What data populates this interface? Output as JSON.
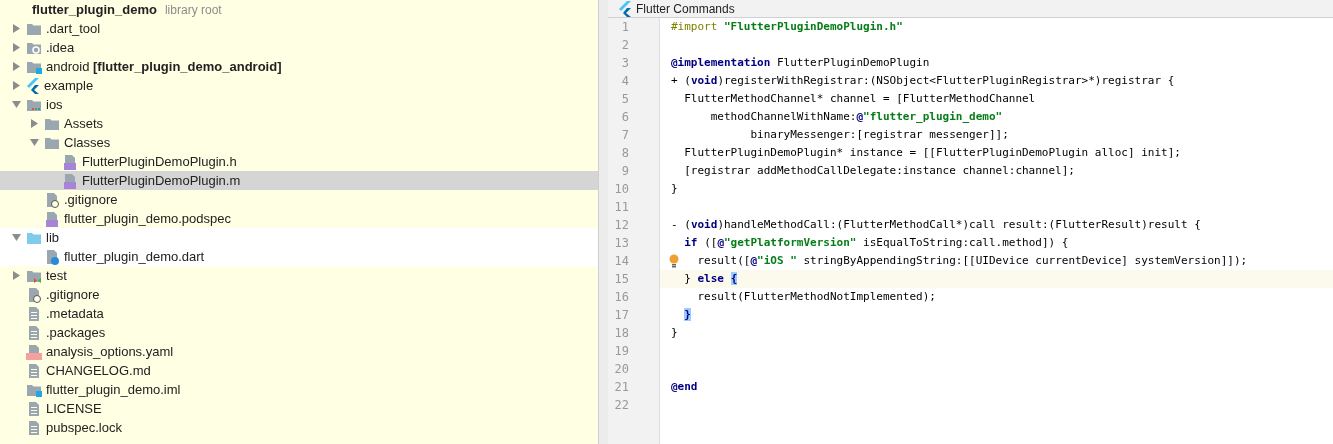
{
  "project_tree": {
    "root": {
      "label": "flutter_plugin_demo",
      "note": "library root"
    },
    "items": [
      {
        "label": ".dart_tool",
        "kind": "folder",
        "expanded": false,
        "selected": false,
        "color": "#ffffe4"
      },
      {
        "label": ".idea",
        "kind": "folder-idea",
        "expanded": false,
        "selected": false,
        "color": "#ffffe4"
      },
      {
        "label": "android **[flutter_plugin_demo_android]**",
        "kind": "folder-module",
        "expanded": false,
        "selected": false,
        "color": "#ffffe4"
      },
      {
        "label": "example",
        "kind": "flutter",
        "expanded": false,
        "selected": false,
        "color": "#ffffe4"
      },
      {
        "label": "ios",
        "kind": "folder-ios",
        "expanded": true,
        "selected": false,
        "color": "#ffffe4",
        "children": [
          {
            "label": "Assets",
            "kind": "folder",
            "expanded": false,
            "selected": false,
            "color": "#ffffe4"
          },
          {
            "label": "Classes",
            "kind": "folder",
            "expanded": true,
            "selected": false,
            "color": "#ffffe4",
            "children": [
              {
                "label": "FlutterPluginDemoPlugin.h",
                "kind": "file-cpp",
                "selected": false,
                "color": "#ffffe4"
              },
              {
                "label": "FlutterPluginDemoPlugin.m",
                "kind": "file-cpp",
                "selected": true
              }
            ]
          },
          {
            "label": ".gitignore",
            "kind": "file-ignore",
            "selected": false,
            "color": "#ffffe4"
          },
          {
            "label": "flutter_plugin_demo.podspec",
            "kind": "file-cpp",
            "selected": false,
            "color": "#ffffe4"
          }
        ]
      },
      {
        "label": "lib",
        "kind": "folder-lib",
        "expanded": true,
        "selected": false,
        "color": "#ffffff",
        "children": [
          {
            "label": "flutter_plugin_demo.dart",
            "kind": "file-dart",
            "selected": false,
            "color": "#ffffff"
          }
        ]
      },
      {
        "label": "test",
        "kind": "folder-test",
        "expanded": false,
        "selected": false,
        "color": "#ffffe4"
      },
      {
        "label": ".gitignore",
        "kind": "file-ignore",
        "selected": false,
        "color": "#ffffe4"
      },
      {
        "label": ".metadata",
        "kind": "file-text",
        "selected": false,
        "color": "#ffffe4"
      },
      {
        "label": ".packages",
        "kind": "file-text",
        "selected": false,
        "color": "#ffffe4"
      },
      {
        "label": "analysis_options.yaml",
        "kind": "file-yaml",
        "selected": false,
        "color": "#ffffe4"
      },
      {
        "label": "CHANGELOG.md",
        "kind": "file-text",
        "selected": false,
        "color": "#ffffe4"
      },
      {
        "label": "flutter_plugin_demo.iml",
        "kind": "folder-module",
        "selected": false,
        "color": "#ffffe4"
      },
      {
        "label": "LICENSE",
        "kind": "file-text",
        "selected": false,
        "color": "#ffffe4"
      },
      {
        "label": "pubspec.lock",
        "kind": "file-text",
        "selected": false,
        "color": "#ffffe4"
      }
    ]
  },
  "editor": {
    "header": "Flutter Commands",
    "lines": [
      {
        "number": "1",
        "tokens": [
          {
            "kind": "directive",
            "text": "#import "
          },
          {
            "kind": "string",
            "text": "\"FlutterPluginDemoPlugin.h\""
          }
        ]
      },
      {
        "number": "2"
      },
      {
        "number": "3",
        "tokens": [
          {
            "kind": "keyword",
            "text": "@implementation"
          },
          {
            "kind": "plain",
            "text": " FlutterPluginDemoPlugin"
          }
        ]
      },
      {
        "number": "4",
        "tokens": [
          {
            "kind": "plain",
            "text": "+ ("
          },
          {
            "kind": "keyword",
            "text": "void"
          },
          {
            "kind": "plain",
            "text": ")registerWithRegistrar:(NSObject<FlutterPluginRegistrar>*)registrar {"
          }
        ]
      },
      {
        "number": "5",
        "tokens": [
          {
            "kind": "plain",
            "text": "  FlutterMethodChannel* channel = [FlutterMethodChannel"
          }
        ]
      },
      {
        "number": "6",
        "tokens": [
          {
            "kind": "plain",
            "text": "      methodChannelWithName:"
          },
          {
            "kind": "keyword",
            "text": "@"
          },
          {
            "kind": "string",
            "text": "\"flutter_plugin_demo\""
          }
        ]
      },
      {
        "number": "7",
        "tokens": [
          {
            "kind": "plain",
            "text": "            binaryMessenger:[registrar messenger]];"
          }
        ]
      },
      {
        "number": "8",
        "tokens": [
          {
            "kind": "plain",
            "text": "  FlutterPluginDemoPlugin* instance = [[FlutterPluginDemoPlugin alloc] init];"
          }
        ]
      },
      {
        "number": "9",
        "tokens": [
          {
            "kind": "plain",
            "text": "  [registrar addMethodCallDelegate:instance channel:channel];"
          }
        ]
      },
      {
        "number": "10",
        "tokens": [
          {
            "kind": "plain",
            "text": "}"
          }
        ]
      },
      {
        "number": "11"
      },
      {
        "number": "12",
        "tokens": [
          {
            "kind": "plain",
            "text": "- ("
          },
          {
            "kind": "keyword",
            "text": "void"
          },
          {
            "kind": "plain",
            "text": ")handleMethodCall:(FlutterMethodCall*)call result:(FlutterResult)result {"
          }
        ]
      },
      {
        "number": "13",
        "tokens": [
          {
            "kind": "keyword",
            "text": "  if"
          },
          {
            "kind": "plain",
            "text": " (["
          },
          {
            "kind": "keyword",
            "text": "@"
          },
          {
            "kind": "string",
            "text": "\"getPlatformVersion\""
          },
          {
            "kind": "plain",
            "text": " isEqualToString:call.method]) {"
          }
        ]
      },
      {
        "number": "14",
        "bulb": true,
        "tokens": [
          {
            "kind": "plain",
            "text": "    result(["
          },
          {
            "kind": "keyword",
            "text": "@"
          },
          {
            "kind": "string",
            "text": "\"iOS \""
          },
          {
            "kind": "plain",
            "text": " stringByAppendingString:[[UIDevice currentDevice] systemVersion]]);"
          }
        ]
      },
      {
        "number": "15",
        "current": true,
        "tokens": [
          {
            "kind": "plain",
            "text": "  } "
          },
          {
            "kind": "keyword",
            "text": "else"
          },
          {
            "kind": "match",
            "text": " {"
          }
        ]
      },
      {
        "number": "16",
        "tokens": [
          {
            "kind": "plain",
            "text": "    result(FlutterMethodNotImplemented);"
          }
        ]
      },
      {
        "number": "17",
        "tokens": [
          {
            "kind": "match",
            "text": "  }"
          }
        ]
      },
      {
        "number": "18",
        "tokens": [
          {
            "kind": "plain",
            "text": "}"
          }
        ]
      },
      {
        "number": "19"
      },
      {
        "number": "20"
      },
      {
        "number": "21",
        "tokens": [
          {
            "kind": "keyword",
            "text": "@end"
          }
        ]
      },
      {
        "number": "22"
      }
    ]
  }
}
